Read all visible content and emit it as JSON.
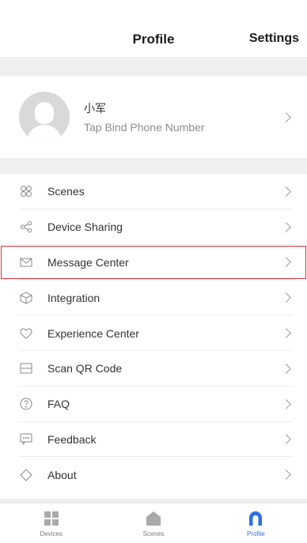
{
  "header": {
    "title": "Profile",
    "settings_label": "Settings"
  },
  "profile": {
    "name": "小军",
    "subtitle": "Tap Bind Phone Number"
  },
  "menu": {
    "items": [
      {
        "label": "Scenes",
        "icon": "scenes-icon"
      },
      {
        "label": "Device Sharing",
        "icon": "share-icon"
      },
      {
        "label": "Message Center",
        "icon": "envelope-icon"
      },
      {
        "label": "Integration",
        "icon": "cube-icon"
      },
      {
        "label": "Experience Center",
        "icon": "heart-icon"
      },
      {
        "label": "Scan QR Code",
        "icon": "scan-icon"
      },
      {
        "label": "FAQ",
        "icon": "question-icon"
      },
      {
        "label": "Feedback",
        "icon": "chat-icon"
      },
      {
        "label": "About",
        "icon": "diamond-icon"
      }
    ]
  },
  "tabbar": {
    "tabs": [
      {
        "label": "Devices",
        "icon": "grid-icon",
        "active": false
      },
      {
        "label": "Scenes",
        "icon": "home-icon",
        "active": false
      },
      {
        "label": "Profile",
        "icon": "profile-icon",
        "active": true
      }
    ]
  },
  "colors": {
    "accent": "#2e6fe0",
    "highlight_border": "#e0313a",
    "separator": "#efefef"
  }
}
